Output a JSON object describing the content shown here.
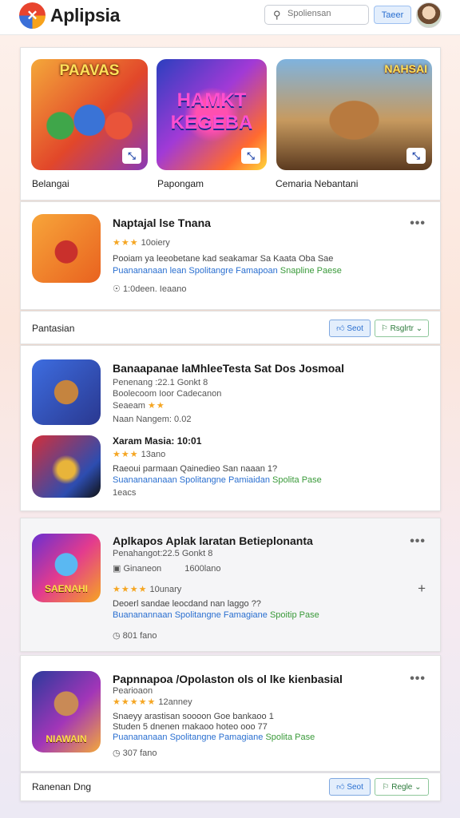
{
  "header": {
    "app_title": "Aplipsia",
    "search_placeholder": "Spoliensan",
    "button_label": "Taeer"
  },
  "featured": [
    {
      "art_text": "PAAVAS",
      "label": "Belangai"
    },
    {
      "art_text": "HAMKT KEGEBA",
      "label": "Papongam"
    },
    {
      "art_text": "NAHSAI",
      "label": "Cemaria Nebantani"
    }
  ],
  "list_1": {
    "title": "Naptajal lse Tnana",
    "rating_stars": "★★★",
    "rating_text": "10oiery",
    "desc_line": "Pooiam ya leeobetane kad seakamar Sa Kaata Oba Sae",
    "desc_blue": "Puanananaan lean Spolitangre Famapoan",
    "desc_green": "Snapline Paese",
    "footer_meta": "1:0deen.  Ieaano"
  },
  "action_row_1": {
    "label": "Pantasian",
    "primary_button": "Seot",
    "secondary_button": "Rsglrtr"
  },
  "list_2": {
    "title": "Banaapanae laMhleeTesta Sat Dos Josmoal",
    "meta_1": "Penenang :22.1 Gonkt 8",
    "meta_2": "Boolecoom  Ioor  Cadecanon",
    "meta_3_prefix": "Seaeam",
    "meta_3_stars": "★★",
    "meta_4": "Naan Nangem:  0.02",
    "sub_title": "Xaram Masia: 10:01",
    "sub_stars": "★★★",
    "sub_rating": "13ano",
    "sub_desc": "Raeoui parmaan Qainedieo San naaan 1?",
    "sub_desc_blue": "Suananananaan Spolitangne Pamiaidan",
    "sub_desc_green": "Spolita Pase",
    "sub_footer": "1eacs"
  },
  "list_3": {
    "title": "Aplkapos Aplak laratan Betieplonanta",
    "meta_1": "Penahangot:22.5 Gonkt 8",
    "meta_2": "Ginaneon",
    "meta_2b": "1600lano",
    "stars": "★★★★",
    "rating": "10unary",
    "desc": "Deoerl sandae leocdand nan laggo ??",
    "desc_blue": "Buananannaan Spolitangne Famagiane",
    "desc_green": "Spoitip Pase",
    "footer": "801 fano",
    "art_text": "SAENAHI"
  },
  "list_4": {
    "title": "Papnnapoa /Opolaston ols ol lke kienbasial",
    "meta_1": "Pearioaon",
    "stars": "★★★★★",
    "rating": "12anney",
    "desc_1": "Snaeyy arastisan soooon Goe bankaoo 1",
    "desc_2": "Studen 5 dnenen rnakaoo hoteo ooo 77",
    "desc_blue": "Puanananaan Spolitangne Pamagiane",
    "desc_green": "Spolita Pase",
    "footer": "307 fano",
    "art_text": "NIAWAIN"
  },
  "action_row_2": {
    "label": "Ranenan Dng",
    "primary_button": "Seot",
    "secondary_button": "Regle"
  }
}
